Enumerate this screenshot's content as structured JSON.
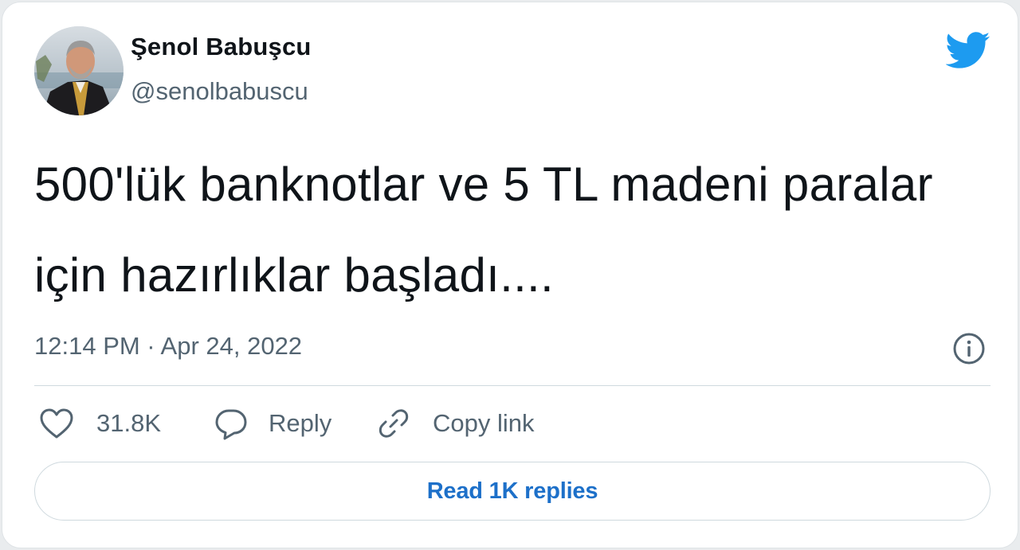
{
  "tweet": {
    "author": {
      "name": "Şenol Babuşcu",
      "handle": "@senolbabuscu",
      "avatar_icon": "profile-photo"
    },
    "brand_icon": "twitter-bird-icon",
    "text": "500'lük banknotlar ve 5 TL madeni paralar için hazırlıklar başladı....",
    "timestamp": "12:14 PM · Apr 24, 2022",
    "info_icon": "info-icon",
    "actions": {
      "like": {
        "icon": "heart-icon",
        "label": "31.8K"
      },
      "reply": {
        "icon": "speech-bubble-icon",
        "label": "Reply"
      },
      "copy": {
        "icon": "link-icon",
        "label": "Copy link"
      }
    },
    "read_replies": "Read 1K replies"
  },
  "colors": {
    "brand_blue": "#1d9bf0",
    "link_blue": "#1d70c9",
    "text_primary": "#0f1419",
    "text_secondary": "#536471",
    "border": "#cfd9de"
  }
}
